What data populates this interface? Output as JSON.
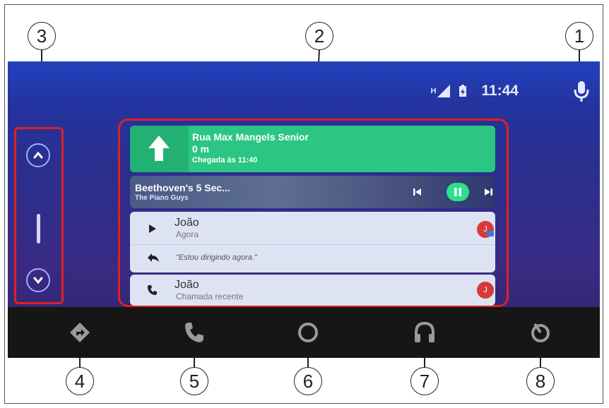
{
  "callouts": [
    "1",
    "2",
    "3",
    "4",
    "5",
    "6",
    "7",
    "8"
  ],
  "status": {
    "network": "H",
    "time": "11:44"
  },
  "rail": {
    "up_icon": "chevron-up-icon",
    "down_icon": "chevron-down-icon"
  },
  "navigation": {
    "street": "Rua Max Mangels Senior",
    "distance": "0 m",
    "eta": "Chegada às 11:40",
    "icon": "arrow-up-icon"
  },
  "media": {
    "title": "Beethoven's 5 Sec...",
    "artist": "The Piano Guys"
  },
  "message": {
    "sender": "João",
    "time": "Agora",
    "avatar": "J",
    "reply_text": "\"Estou dirigindo agora.\""
  },
  "call": {
    "caller": "João",
    "detail": "Chamada recente",
    "avatar": "J"
  },
  "bottom_nav": [
    "navigation-icon",
    "phone-icon",
    "home-icon",
    "headphones-icon",
    "exit-icon"
  ],
  "colors": {
    "accent": "#2bc683",
    "highlight": "#e02020",
    "play_button": "#2ee08a"
  }
}
